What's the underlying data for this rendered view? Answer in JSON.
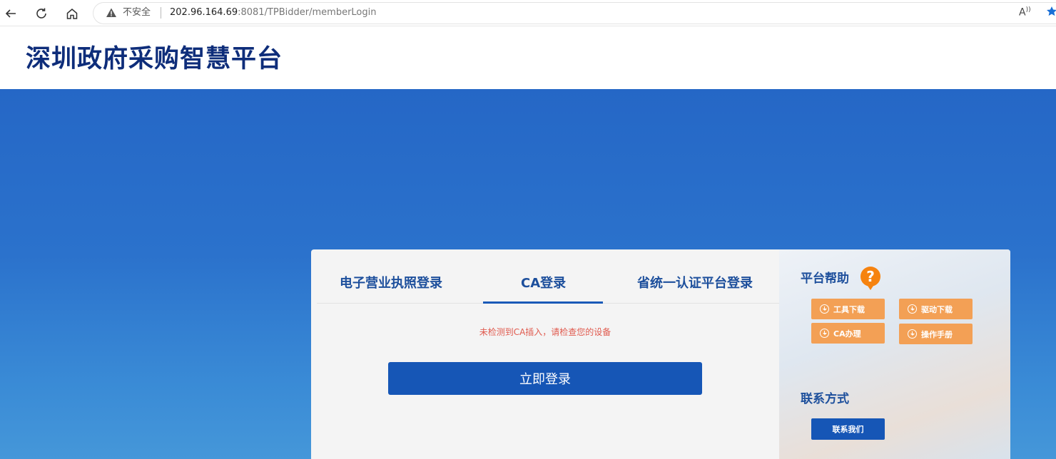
{
  "browser": {
    "insecure_label": "不安全",
    "url_host": "202.96.164.69",
    "url_rest": ":8081/TPBidder/memberLogin"
  },
  "site": {
    "title": "深圳政府采购智慧平台"
  },
  "login": {
    "tabs": [
      {
        "label": "电子营业执照登录",
        "active": false
      },
      {
        "label": "CA登录",
        "active": true
      },
      {
        "label": "省统一认证平台登录",
        "active": false
      }
    ],
    "error": "未检测到CA插入，请检查您的设备",
    "submit_label": "立即登录"
  },
  "help": {
    "title": "平台帮助",
    "buttons": [
      {
        "label": "工具下载"
      },
      {
        "label": "驱动下载"
      },
      {
        "label": "CA办理"
      },
      {
        "label": "操作手册"
      }
    ],
    "contact_title": "联系方式",
    "contact_button": "联系我们"
  },
  "colors": {
    "brand_blue": "#1656b6",
    "title_navy": "#0e2d7a",
    "accent_orange": "#f3a055",
    "error_red": "#e05a4e"
  }
}
